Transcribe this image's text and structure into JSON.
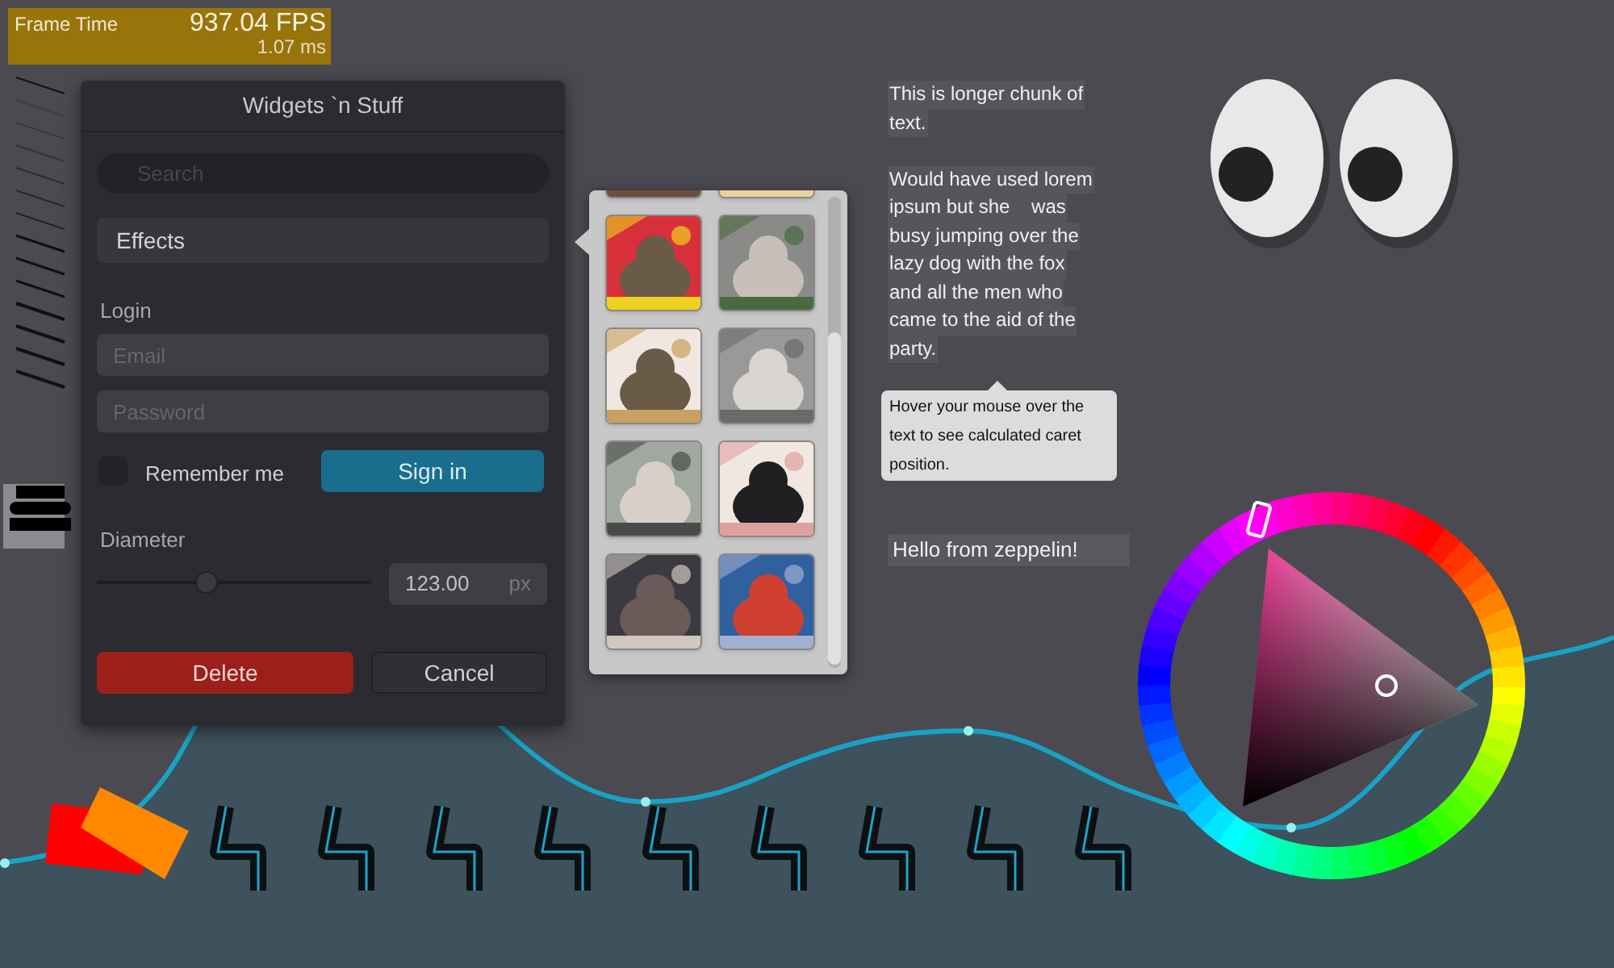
{
  "frame_time": {
    "label": "Frame Time",
    "fps": "937.04 FPS",
    "ms": "1.07 ms"
  },
  "panel": {
    "title": "Widgets `n Stuff",
    "search": {
      "placeholder": "Search"
    },
    "dropdown": "Effects",
    "login_label": "Login",
    "email": {
      "placeholder": "Email"
    },
    "password": {
      "placeholder": "Password"
    },
    "remember": {
      "label": "Remember me",
      "checked": false
    },
    "sign_in": "Sign in",
    "diameter_label": "Diameter",
    "slider": {
      "level": 0.4
    },
    "diameter_value": "123.00",
    "diameter_unit": "px",
    "delete": "Delete",
    "cancel": "Cancel"
  },
  "paragraphs": [
    [
      "This is longer chunk of",
      "text."
    ],
    [
      "Would have used lorem",
      "ipsum but she    was",
      "busy jumping over the",
      "lazy dog with the fox",
      "and all the men who",
      "came to the aid of the",
      "party."
    ]
  ],
  "tooltip": "Hover your mouse over the text to see calculated caret position.",
  "zeppelin": "Hello from zeppelin!"
}
